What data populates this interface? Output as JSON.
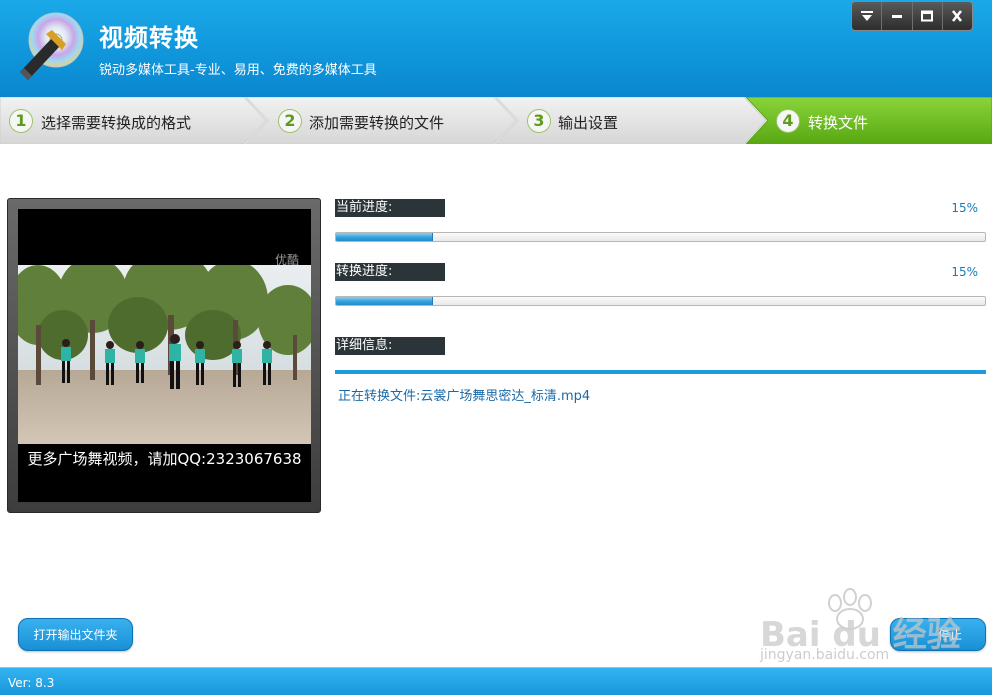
{
  "app": {
    "title": "视频转换",
    "subtitle": "锐动多媒体工具-专业、易用、免费的多媒体工具"
  },
  "window_controls": [
    "menu-icon",
    "minimize-icon",
    "maximize-icon",
    "close-icon"
  ],
  "steps": [
    {
      "num": "1",
      "label": "选择需要转换成的格式",
      "active": false
    },
    {
      "num": "2",
      "label": "添加需要转换的文件",
      "active": false
    },
    {
      "num": "3",
      "label": "输出设置",
      "active": false
    },
    {
      "num": "4",
      "label": "转换文件",
      "active": true
    }
  ],
  "video": {
    "watermark": "优酷",
    "caption": "更多广场舞视频，请加QQ:2323067638"
  },
  "progress": {
    "current_label": "当前进度:",
    "current_pct_text": "15%",
    "current_value": 0.15,
    "convert_label": "转换进度:",
    "convert_pct_text": "15%",
    "convert_value": 0.15
  },
  "detail": {
    "label": "详细信息:",
    "text": "正在转换文件:云裳广场舞思密达_标清.mp4"
  },
  "buttons": {
    "open_output": "打开输出文件夹",
    "stop": "停止"
  },
  "footer": {
    "version": "Ver: 8.3"
  },
  "overlay_watermark": {
    "brand": "Bai du 经验",
    "url": "jingyan.baidu.com"
  },
  "colors": {
    "header_blue": "#1096db",
    "active_step_green": "#6fc21d",
    "progress_blue": "#3aa3dc"
  }
}
